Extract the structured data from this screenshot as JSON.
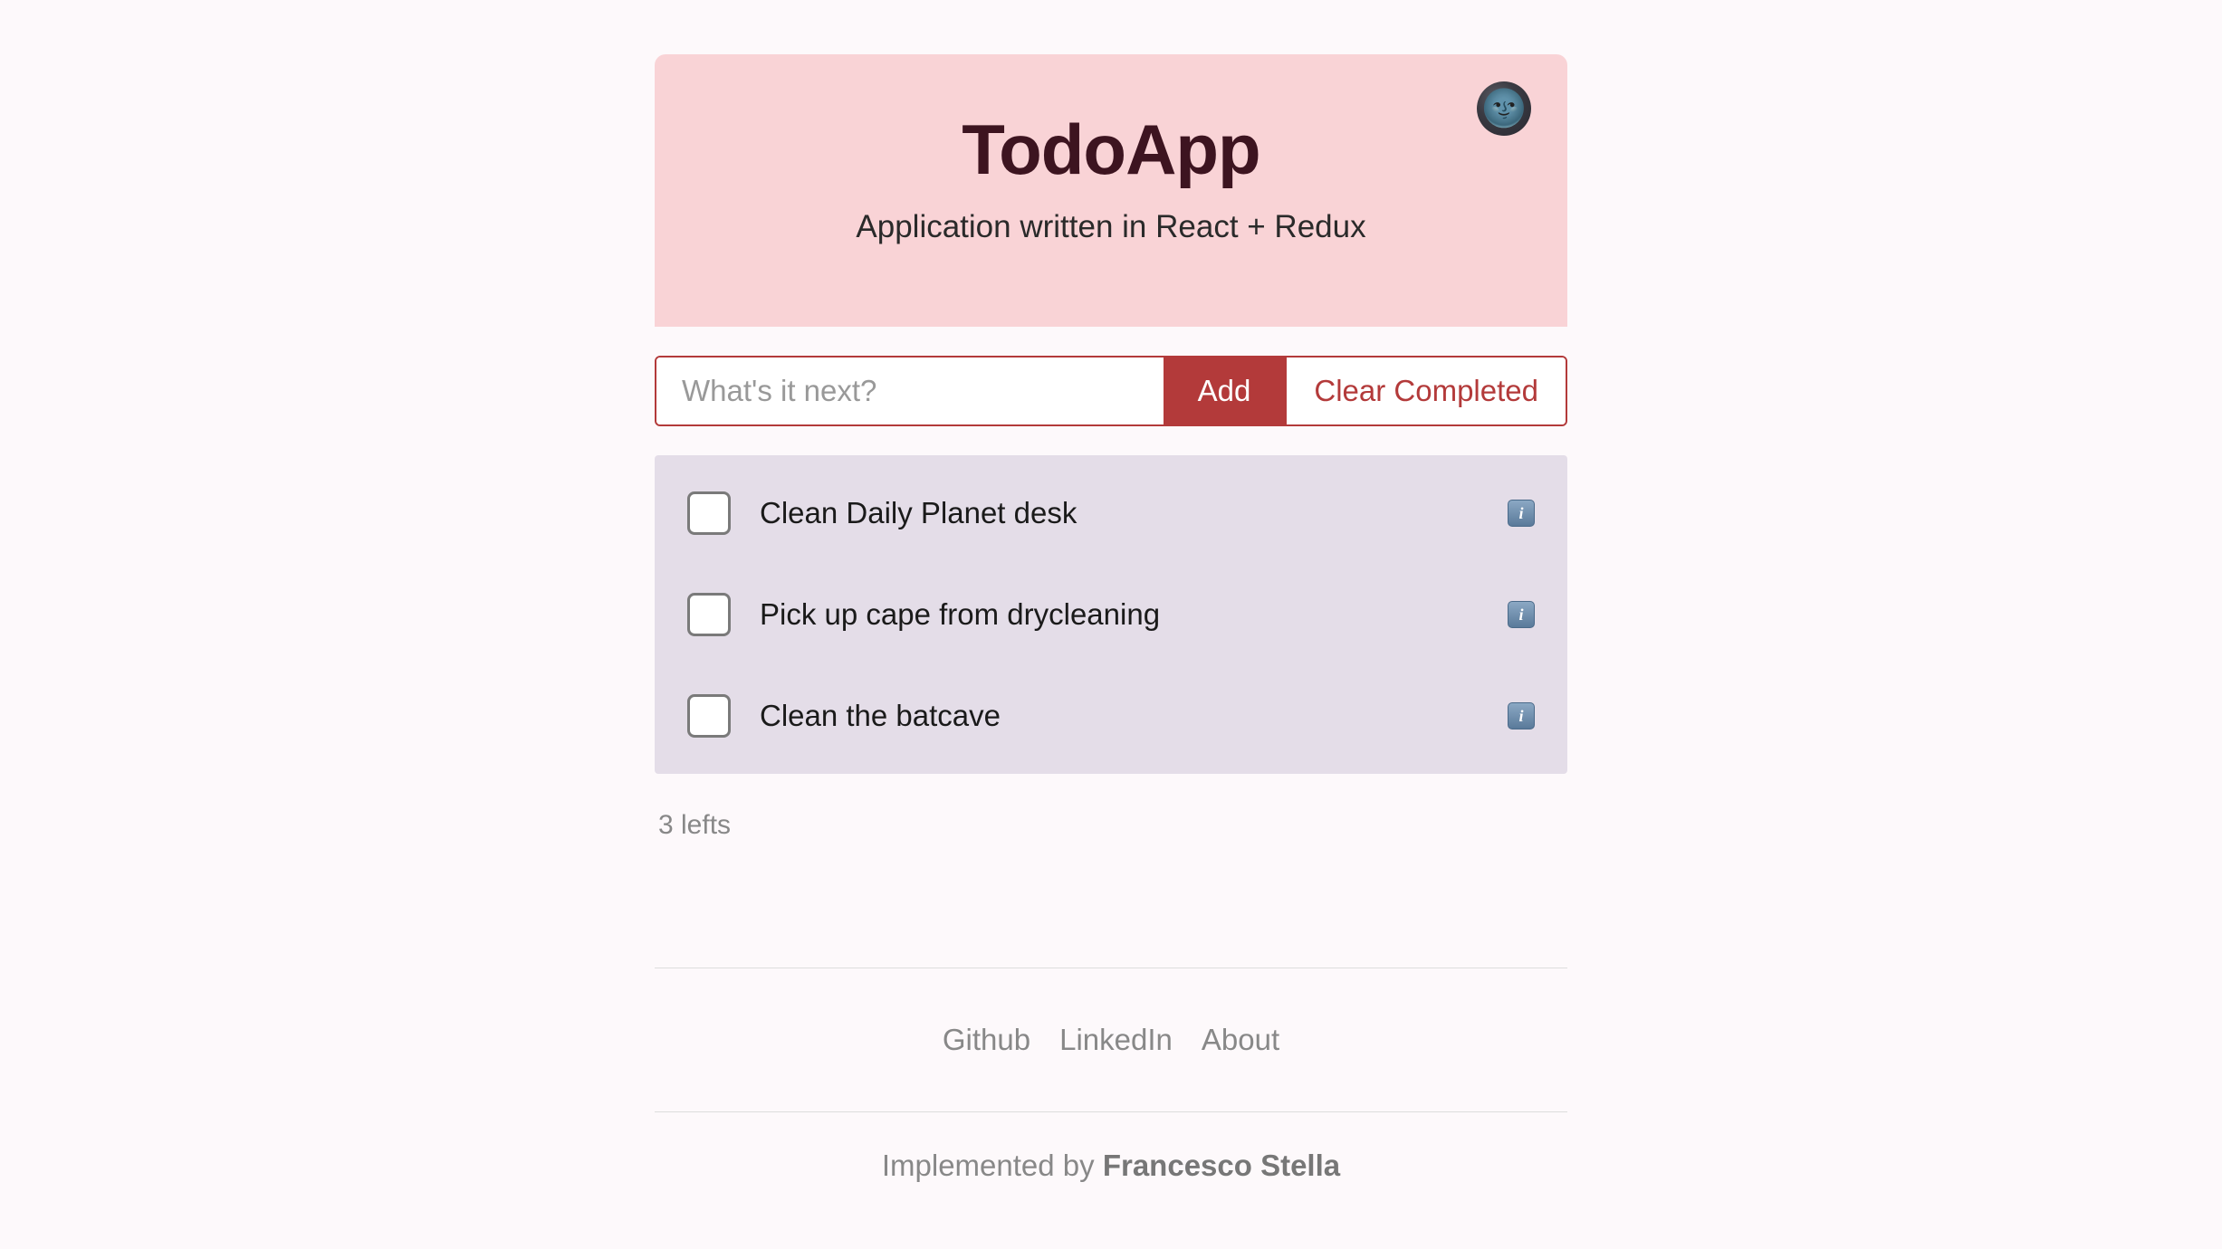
{
  "header": {
    "title": "TodoApp",
    "subtitle": "Application written in React + Redux",
    "theme_icon": "🌚"
  },
  "input": {
    "placeholder": "What's it next?",
    "add_label": "Add",
    "clear_label": "Clear Completed"
  },
  "todos": [
    {
      "text": "Clean Daily Planet desk",
      "done": false
    },
    {
      "text": "Pick up cape from drycleaning",
      "done": false
    },
    {
      "text": "Clean the batcave",
      "done": false
    }
  ],
  "counter": "3 lefts",
  "footer": {
    "links": [
      "Github",
      "LinkedIn",
      "About"
    ],
    "credit_prefix": "Implemented by ",
    "credit_name": "Francesco Stella"
  }
}
